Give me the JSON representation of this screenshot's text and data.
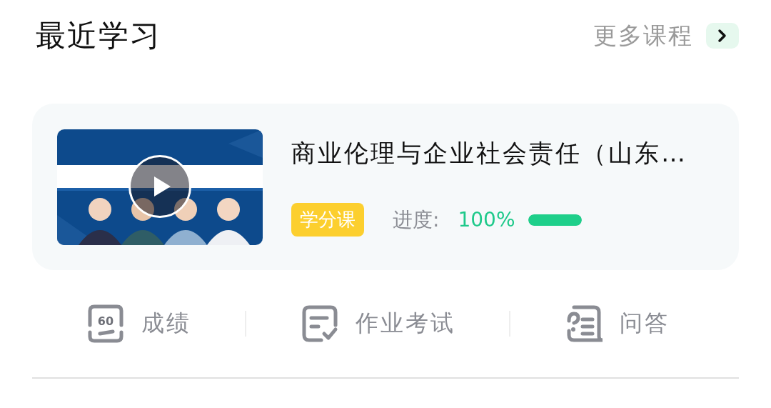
{
  "header": {
    "title": "最近学习",
    "more_link": "更多课程"
  },
  "course": {
    "title": "商业伦理与企业社会责任（山东…",
    "tag": "学分课",
    "progress_label": "进度:",
    "progress_value": "100%",
    "level": 1.0
  },
  "actions": [
    {
      "kind": "grade",
      "label": "成绩",
      "icon_text": "60"
    },
    {
      "kind": "homework",
      "label": "作业考试"
    },
    {
      "kind": "qa",
      "label": "问答"
    }
  ]
}
